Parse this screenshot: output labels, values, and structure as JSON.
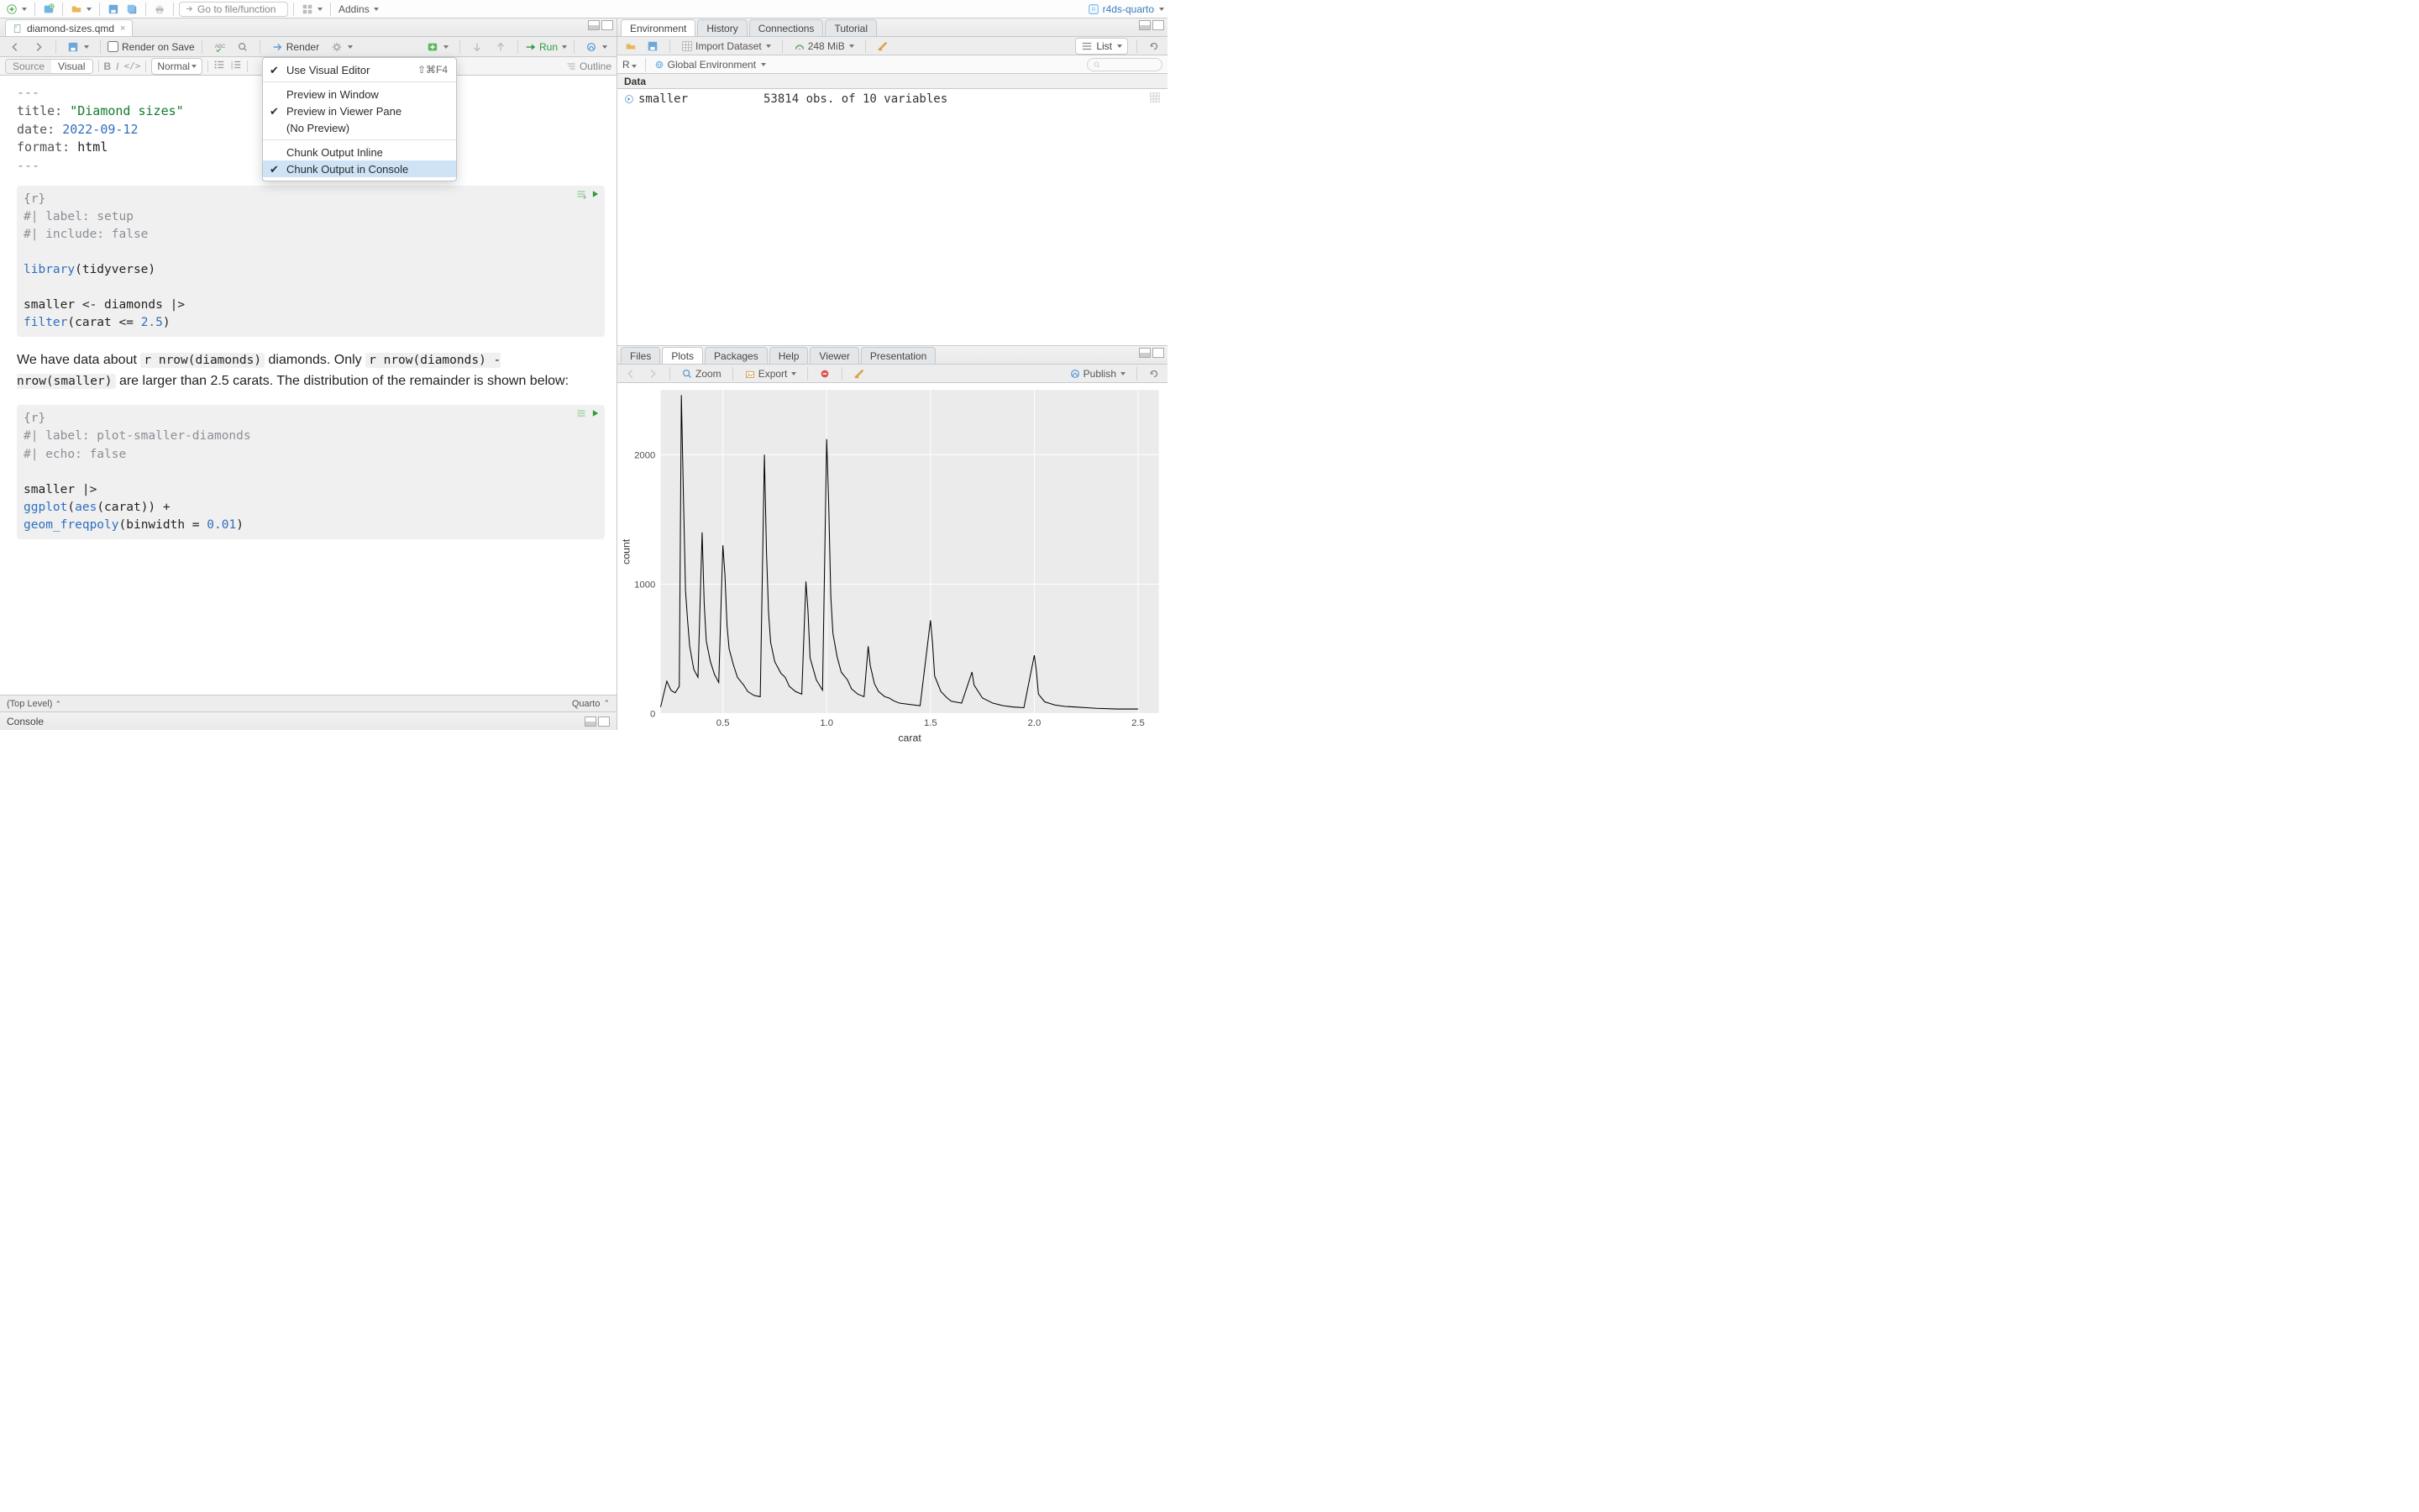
{
  "global": {
    "goto_placeholder": "Go to file/function",
    "addins": "Addins",
    "project": "r4ds-quarto"
  },
  "file_tab": "diamond-sizes.qmd",
  "ed_toolbar": {
    "render_on_save": "Render on Save",
    "render": "Render",
    "run": "Run",
    "outline": "Outline"
  },
  "format_bar": {
    "source": "Source",
    "visual": "Visual",
    "normal": "Normal"
  },
  "dropdown": {
    "visual": "Use Visual Editor",
    "visual_kb": "⇧⌘F4",
    "prev_window": "Preview in Window",
    "prev_viewer": "Preview in Viewer Pane",
    "no_preview": "(No Preview)",
    "inline": "Chunk Output Inline",
    "console": "Chunk Output in Console"
  },
  "yaml": {
    "dash": "---",
    "title_k": "title:",
    "title_v": "\"Diamond sizes\"",
    "date_k": "date:",
    "date_v": "2022-09-12",
    "fmt_k": "format:",
    "fmt_v": "html"
  },
  "chunk1": {
    "tag": "{r}",
    "l1": "#| label: setup",
    "l2": "#| include: false",
    "l3a": "library",
    "l3b": "(tidyverse)",
    "l4": "smaller <- diamonds |>",
    "l5a": "  filter",
    "l5b": "(carat <= ",
    "l5c": "2.5",
    "l5d": ")"
  },
  "prose": {
    "p1a": "We have data about ",
    "ic1": "r nrow(diamonds)",
    "p1b": " diamonds. Only ",
    "ic2": "r nrow(diamonds) - nrow(smaller)",
    "p1c": " are larger than 2.5 carats. The distribution of the remainder is shown below:"
  },
  "chunk2": {
    "tag": "{r}",
    "l1": "#| label: plot-smaller-diamonds",
    "l2": "#| echo: false",
    "l3": "smaller |>",
    "l4a": "  ggplot",
    "l4b": "(",
    "l4c": "aes",
    "l4d": "(carat)) +",
    "l5a": "  geom_freqpoly",
    "l5b": "(binwidth = ",
    "l5c": "0.01",
    "l5d": ")"
  },
  "status": {
    "scope": "(Top Level)",
    "fmt": "Quarto"
  },
  "console_tab": "Console",
  "env": {
    "tabs": [
      "Environment",
      "History",
      "Connections",
      "Tutorial"
    ],
    "import": "Import Dataset",
    "mem": "248 MiB",
    "list": "List",
    "scope_r": "R",
    "scope_global": "Global Environment",
    "data_hdr": "Data",
    "row_name": "smaller",
    "row_desc": "53814 obs. of 10 variables"
  },
  "plots": {
    "tabs": [
      "Files",
      "Plots",
      "Packages",
      "Help",
      "Viewer",
      "Presentation"
    ],
    "zoom": "Zoom",
    "export": "Export",
    "publish": "Publish"
  },
  "chart_data": {
    "type": "line",
    "title": "",
    "xlabel": "carat",
    "ylabel": "count",
    "xlim": [
      0.2,
      2.6
    ],
    "ylim": [
      0,
      2500
    ],
    "xticks": [
      0.5,
      1.0,
      1.5,
      2.0,
      2.5
    ],
    "yticks": [
      0,
      1000,
      2000
    ],
    "x": [
      0.2,
      0.23,
      0.25,
      0.27,
      0.29,
      0.3,
      0.31,
      0.32,
      0.33,
      0.34,
      0.35,
      0.36,
      0.38,
      0.4,
      0.41,
      0.42,
      0.44,
      0.46,
      0.48,
      0.5,
      0.51,
      0.52,
      0.53,
      0.55,
      0.57,
      0.6,
      0.62,
      0.65,
      0.68,
      0.7,
      0.71,
      0.72,
      0.73,
      0.75,
      0.78,
      0.8,
      0.82,
      0.85,
      0.88,
      0.9,
      0.91,
      0.92,
      0.95,
      0.98,
      1.0,
      1.01,
      1.02,
      1.03,
      1.05,
      1.07,
      1.1,
      1.12,
      1.15,
      1.18,
      1.2,
      1.21,
      1.23,
      1.25,
      1.28,
      1.3,
      1.32,
      1.35,
      1.4,
      1.45,
      1.5,
      1.51,
      1.52,
      1.55,
      1.58,
      1.6,
      1.65,
      1.7,
      1.71,
      1.75,
      1.8,
      1.85,
      1.9,
      1.95,
      2.0,
      2.01,
      2.02,
      2.05,
      2.1,
      2.15,
      2.2,
      2.25,
      2.3,
      2.4,
      2.5
    ],
    "y": [
      50,
      250,
      180,
      160,
      210,
      2460,
      1680,
      950,
      720,
      520,
      430,
      340,
      280,
      1400,
      850,
      560,
      400,
      300,
      240,
      1300,
      1070,
      680,
      500,
      380,
      280,
      220,
      170,
      140,
      130,
      2000,
      1250,
      780,
      550,
      400,
      310,
      280,
      210,
      170,
      150,
      1020,
      790,
      430,
      260,
      180,
      2120,
      1600,
      900,
      620,
      440,
      320,
      260,
      190,
      150,
      130,
      520,
      370,
      230,
      170,
      130,
      120,
      100,
      80,
      70,
      60,
      720,
      540,
      290,
      170,
      120,
      95,
      80,
      320,
      220,
      120,
      80,
      60,
      50,
      45,
      450,
      330,
      150,
      90,
      65,
      55,
      50,
      45,
      40,
      35,
      35
    ]
  }
}
